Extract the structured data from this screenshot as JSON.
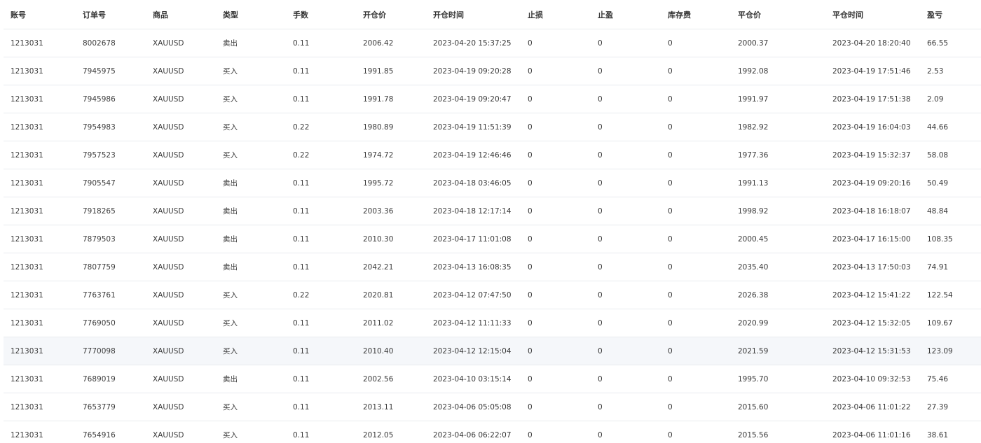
{
  "columns": [
    "账号",
    "订单号",
    "商品",
    "类型",
    "手数",
    "开仓价",
    "开仓时间",
    "止损",
    "止盈",
    "库存费",
    "平仓价",
    "平仓时间",
    "盈亏"
  ],
  "rows": [
    [
      "1213031",
      "8002678",
      "XAUUSD",
      "卖出",
      "0.11",
      "2006.42",
      "2023-04-20 15:37:25",
      "0",
      "0",
      "0",
      "2000.37",
      "2023-04-20 18:20:40",
      "66.55"
    ],
    [
      "1213031",
      "7945975",
      "XAUUSD",
      "买入",
      "0.11",
      "1991.85",
      "2023-04-19 09:20:28",
      "0",
      "0",
      "0",
      "1992.08",
      "2023-04-19 17:51:46",
      "2.53"
    ],
    [
      "1213031",
      "7945986",
      "XAUUSD",
      "买入",
      "0.11",
      "1991.78",
      "2023-04-19 09:20:47",
      "0",
      "0",
      "0",
      "1991.97",
      "2023-04-19 17:51:38",
      "2.09"
    ],
    [
      "1213031",
      "7954983",
      "XAUUSD",
      "买入",
      "0.22",
      "1980.89",
      "2023-04-19 11:51:39",
      "0",
      "0",
      "0",
      "1982.92",
      "2023-04-19 16:04:03",
      "44.66"
    ],
    [
      "1213031",
      "7957523",
      "XAUUSD",
      "买入",
      "0.22",
      "1974.72",
      "2023-04-19 12:46:46",
      "0",
      "0",
      "0",
      "1977.36",
      "2023-04-19 15:32:37",
      "58.08"
    ],
    [
      "1213031",
      "7905547",
      "XAUUSD",
      "卖出",
      "0.11",
      "1995.72",
      "2023-04-18 03:46:05",
      "0",
      "0",
      "0",
      "1991.13",
      "2023-04-19 09:20:16",
      "50.49"
    ],
    [
      "1213031",
      "7918265",
      "XAUUSD",
      "卖出",
      "0.11",
      "2003.36",
      "2023-04-18 12:17:14",
      "0",
      "0",
      "0",
      "1998.92",
      "2023-04-18 16:18:07",
      "48.84"
    ],
    [
      "1213031",
      "7879503",
      "XAUUSD",
      "卖出",
      "0.11",
      "2010.30",
      "2023-04-17 11:01:08",
      "0",
      "0",
      "0",
      "2000.45",
      "2023-04-17 16:15:00",
      "108.35"
    ],
    [
      "1213031",
      "7807759",
      "XAUUSD",
      "卖出",
      "0.11",
      "2042.21",
      "2023-04-13 16:08:35",
      "0",
      "0",
      "0",
      "2035.40",
      "2023-04-13 17:50:03",
      "74.91"
    ],
    [
      "1213031",
      "7763761",
      "XAUUSD",
      "买入",
      "0.22",
      "2020.81",
      "2023-04-12 07:47:50",
      "0",
      "0",
      "0",
      "2026.38",
      "2023-04-12 15:41:22",
      "122.54"
    ],
    [
      "1213031",
      "7769050",
      "XAUUSD",
      "买入",
      "0.11",
      "2011.02",
      "2023-04-12 11:11:33",
      "0",
      "0",
      "0",
      "2020.99",
      "2023-04-12 15:32:05",
      "109.67"
    ],
    [
      "1213031",
      "7770098",
      "XAUUSD",
      "买入",
      "0.11",
      "2010.40",
      "2023-04-12 12:15:04",
      "0",
      "0",
      "0",
      "2021.59",
      "2023-04-12 15:31:53",
      "123.09"
    ],
    [
      "1213031",
      "7689019",
      "XAUUSD",
      "卖出",
      "0.11",
      "2002.56",
      "2023-04-10 03:15:14",
      "0",
      "0",
      "0",
      "1995.70",
      "2023-04-10 09:32:53",
      "75.46"
    ],
    [
      "1213031",
      "7653779",
      "XAUUSD",
      "买入",
      "0.11",
      "2013.11",
      "2023-04-06 05:05:08",
      "0",
      "0",
      "0",
      "2015.60",
      "2023-04-06 11:01:22",
      "27.39"
    ],
    [
      "1213031",
      "7654916",
      "XAUUSD",
      "买入",
      "0.11",
      "2012.05",
      "2023-04-06 06:22:07",
      "0",
      "0",
      "0",
      "2015.56",
      "2023-04-06 11:01:16",
      "38.61"
    ]
  ],
  "highlighted_row_index": 11,
  "colors": {
    "row_highlight": "#f5f7fa",
    "row_border": "#e8ebef"
  }
}
